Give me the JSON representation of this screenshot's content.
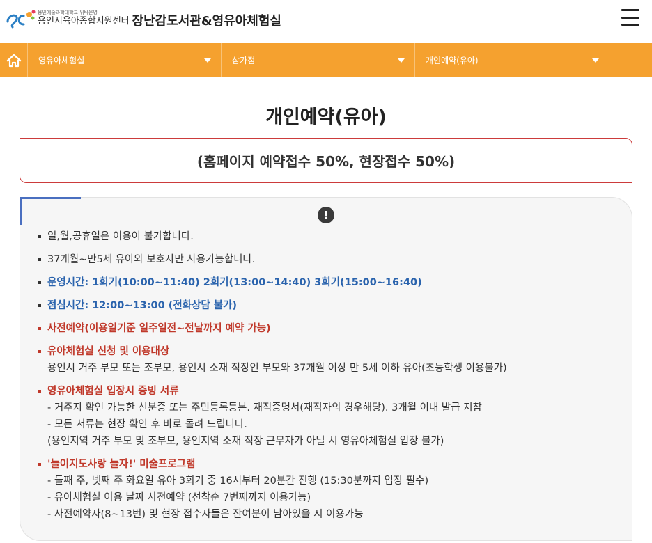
{
  "header": {
    "logo_sub": "용인예술과학대학교 위탁운영",
    "logo_org": "용인시육아종합지원센터",
    "logo_title": "장난감도서관&영유아체험실",
    "menu_icon": "hamburger-menu-icon"
  },
  "nav": {
    "home_icon": "home-icon",
    "items": [
      {
        "label": "영유아체험실"
      },
      {
        "label": "삼가점"
      },
      {
        "label": "개인예약(유아)"
      }
    ],
    "color": "#f5a12f"
  },
  "page": {
    "title": "개인예약(유아)",
    "notice": "(홈페이지 예약접수 50%, 현장접수 50%)"
  },
  "info": {
    "icon": "alert-icon",
    "items": [
      {
        "text": "일,월,공휴일은 이용이 불가합니다."
      },
      {
        "text": "37개월~만5세 유아와 보호자만 사용가능합니다."
      },
      {
        "text": "운영시간: 1회기(10:00~11:40) 2회기(13:00~14:40) 3회기(15:00~16:40)"
      },
      {
        "text": "점심시간: 12:00~13:00 (전화상담 불가)"
      },
      {
        "text": "사전예약(이용일기준 일주일전~전날까지 예약 가능)"
      },
      {
        "head": "유아체험실 신청 및 이용대상",
        "lines": [
          "용인시 거주 부모 또는 조부모, 용인시 소재 직장인 부모와 37개월 이상 만 5세 이하 유아(초등학생 이용불가)"
        ]
      },
      {
        "head": "영유아체험실 입장시 증빙 서류",
        "lines": [
          "- 거주지 확인 가능한 신분증 또는 주민등록등본. 재직증명서(재직자의 경우해당). 3개월 이내 발급 지참",
          "- 모든 서류는 현장 확인 후 바로 돌려 드립니다.",
          "(용인지역 거주 부모 및 조부모, 용인지역 소재 직장 근무자가 아닐 시 영유아체험실 입장 불가)"
        ]
      },
      {
        "head": "'놀이지도사랑 놀자!' 미술프로그램",
        "lines": [
          "- 둘째 주, 넷째 주 화요일 유아 3회기 중 16시부터 20분간 진행 (15:30분까지 입장 필수)",
          "- 유아체험실 이용 날짜 사전예약 (선착순 7번째까지 이용가능)",
          "- 사전예약자(8~13번) 및 현장 접수자들은 잔여분이 남아있을 시 이용가능"
        ]
      }
    ]
  }
}
